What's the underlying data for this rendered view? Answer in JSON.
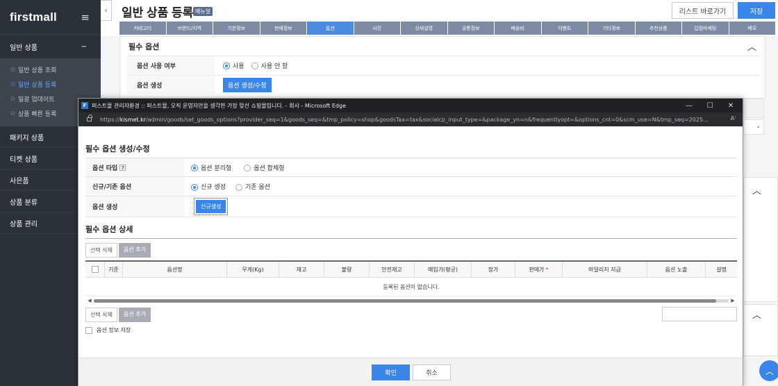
{
  "sidebar": {
    "logo": "firstmall",
    "menu_icon": "≡",
    "group_general": "일반 상품",
    "group_toggle": "−",
    "sub_items": [
      {
        "label": "일반 상품 조회",
        "active": false
      },
      {
        "label": "일반 상품 등록",
        "active": true
      },
      {
        "label": "일괄 업데이트",
        "active": false
      },
      {
        "label": "상품 빠른 등록",
        "active": false
      }
    ],
    "items": [
      "패키지 상품",
      "티켓 상품",
      "사은품",
      "상품 분류",
      "상품 관리"
    ]
  },
  "header": {
    "collapse_icon": "‹",
    "title": "일반 상품 등록",
    "manual_badge": "매뉴얼",
    "list_button": "리스트 바로가기",
    "save_button": "저장"
  },
  "tabs": [
    {
      "label": "카테고리",
      "active": false
    },
    {
      "label": "브랜드/지역",
      "active": false
    },
    {
      "label": "기본정보",
      "active": false
    },
    {
      "label": "판매정보",
      "active": false
    },
    {
      "label": "옵션",
      "active": true
    },
    {
      "label": "사진",
      "active": false
    },
    {
      "label": "상세설명",
      "active": false
    },
    {
      "label": "공통정보",
      "active": false
    },
    {
      "label": "배송비",
      "active": false
    },
    {
      "label": "이벤트",
      "active": false
    },
    {
      "label": "기타정보",
      "active": false
    },
    {
      "label": "추천상품",
      "active": false
    },
    {
      "label": "입점마케팅",
      "active": false
    },
    {
      "label": "메모",
      "active": false
    }
  ],
  "bg_panel": {
    "title": "필수 옵션",
    "chevron": "︿",
    "use_label": "옵션 사용 여부",
    "use_yes": "사용",
    "use_no": "사용 안 함",
    "gen_label": "옵션 생성",
    "gen_button": "옵션 생성/수정"
  },
  "popup": {
    "window_title": "퍼스트몰 관리자환경 :: 퍼스트몰, 오직 운영자만을 생각한 가장 앞선 쇼핑몰입니다. - 회사 - Microsoft Edge",
    "url_prefix": "https://",
    "url_host": "kismet.kr",
    "url_path": "/admin/goods/set_goods_options?provider_seq=1&goods_seq=&tmp_policy=shop&goodsTax=tax&socialcp_input_type=&package_yn=n&frequentlyopt=&options_cnt=0&scm_use=N&tmp_seq=2025...",
    "reader_icon": "A⁾",
    "section1_title": "필수 옵션 생성/수정",
    "option_type_label": "옵션 타입",
    "help_mark": "?",
    "option_type_sep": "옵션 분리형",
    "option_type_merge": "옵션 합체형",
    "new_exist_label": "신규/기존 옵션",
    "new_option": "신규 생성",
    "exist_option": "기존 옵션",
    "create_label": "옵션 생성",
    "create_button": "신규생성",
    "section2_title": "필수 옵션 상세",
    "delete_selected": "선택 삭제",
    "add_option": "옵션 추가",
    "columns": [
      "기준",
      "옵션명",
      "무게(Kg)",
      "재고",
      "불량",
      "안전재고",
      "매입가(평균)",
      "정가",
      "판매가",
      "마일리지 지급",
      "옵션 노출",
      "설명"
    ],
    "required_mark": "*",
    "empty_message": "등록된 옵션이 없습니다.",
    "save_option_info": "옵션 정보 저장",
    "ok_button": "확인",
    "cancel_button": "취소",
    "scroll_left": "◀",
    "scroll_right": "▶"
  },
  "window_controls": {
    "minimize": "—",
    "maximize": "☐",
    "close": "✕"
  },
  "scroll_top_icon": "︿"
}
